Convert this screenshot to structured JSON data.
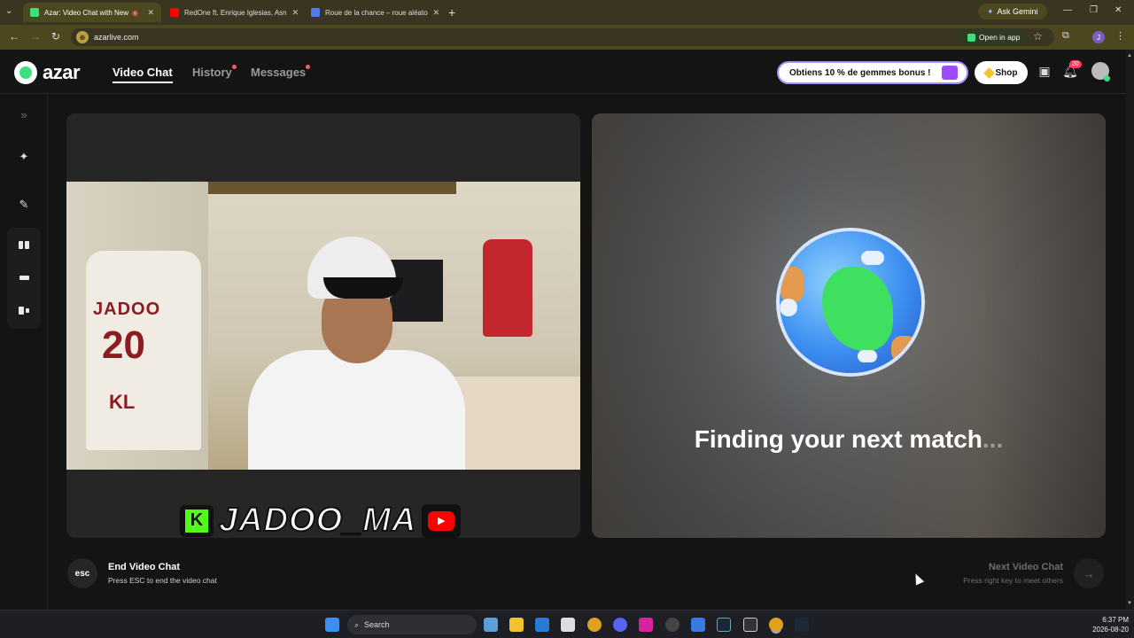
{
  "browser": {
    "tabs": [
      {
        "label": "Azar: Video Chat with New",
        "active": true,
        "favicon_color": "#39e07c"
      },
      {
        "label": "RedOne ft. Enrique Iglesias, Asn",
        "active": false,
        "favicon_color": "#ff0000"
      },
      {
        "label": "Roue de la chance – roue aléato",
        "active": false,
        "favicon_color": "#4f7cf0"
      }
    ],
    "ask_gemini": "Ask Gemini",
    "url": "azarlive.com",
    "open_in_app": "Open in app",
    "profile_initial": "J"
  },
  "app": {
    "logo": "azar",
    "nav": [
      {
        "label": "Video Chat",
        "active": true,
        "dot": false
      },
      {
        "label": "History",
        "active": false,
        "dot": true
      },
      {
        "label": "Messages",
        "active": false,
        "dot": true
      }
    ],
    "promo": "Obtiens 10 % de gemmes bonus !",
    "shop": "Shop",
    "notification_count": "20",
    "accent": "#39e07c"
  },
  "stream": {
    "streamer_name": "JADOO_MA",
    "kick_letter": "K",
    "jersey_name": "JADOO",
    "jersey_number": "20",
    "jersey_initials": "KL"
  },
  "match": {
    "status_text": "Finding your next match",
    "status_dots": "..."
  },
  "controls": {
    "esc_key": "esc",
    "end_title": "End Video Chat",
    "end_hint": "Press ESC to end the video chat",
    "next_title": "Next Video Chat",
    "next_hint": "Press right key to meet others"
  },
  "taskbar": {
    "search_placeholder": "Search",
    "time": "6:37 PM",
    "date": "2026-08-20"
  }
}
